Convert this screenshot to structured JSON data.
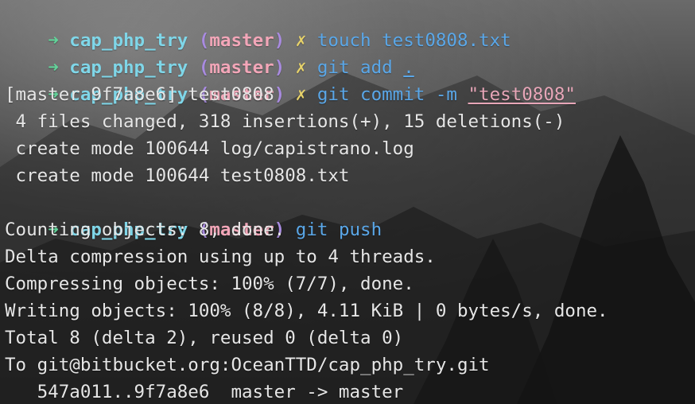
{
  "colors": {
    "arrow": "#63d39a",
    "repo": "#7fd6e8",
    "paren": "#a98be0",
    "branch": "#f2a6b8",
    "dirty_mark": "#e8d36a",
    "command": "#5aa7e8",
    "string_arg": "#e7a6b8",
    "output": "#e6e6e6"
  },
  "prompt": {
    "arrow": "➜",
    "repo": "cap_php_try",
    "paren_open": "(",
    "branch": "master",
    "paren_close": ")",
    "dirty_mark": "✗"
  },
  "lines": [
    {
      "type": "prompt",
      "dirty": true,
      "command": "touch test0808.txt"
    },
    {
      "type": "prompt",
      "dirty": true,
      "command": "git add",
      "arg": "."
    },
    {
      "type": "prompt",
      "dirty": true,
      "command": "git commit -m",
      "arg": "\"test0808\""
    },
    {
      "type": "output",
      "text": "[master 9f7a8e6] test0808"
    },
    {
      "type": "output",
      "text": " 4 files changed, 318 insertions(+), 15 deletions(-)"
    },
    {
      "type": "output",
      "text": " create mode 100644 log/capistrano.log"
    },
    {
      "type": "output",
      "text": " create mode 100644 test0808.txt"
    },
    {
      "type": "prompt",
      "dirty": false,
      "command": "git push"
    },
    {
      "type": "output",
      "text": "Counting objects: 8, done."
    },
    {
      "type": "output",
      "text": "Delta compression using up to 4 threads."
    },
    {
      "type": "output",
      "text": "Compressing objects: 100% (7/7), done."
    },
    {
      "type": "output",
      "text": "Writing objects: 100% (8/8), 4.11 KiB | 0 bytes/s, done."
    },
    {
      "type": "output",
      "text": "Total 8 (delta 2), reused 0 (delta 0)"
    },
    {
      "type": "output",
      "text": "To git@bitbucket.org:OceanTTD/cap_php_try.git"
    },
    {
      "type": "output",
      "text": "   547a011..9f7a8e6  master -> master"
    }
  ]
}
